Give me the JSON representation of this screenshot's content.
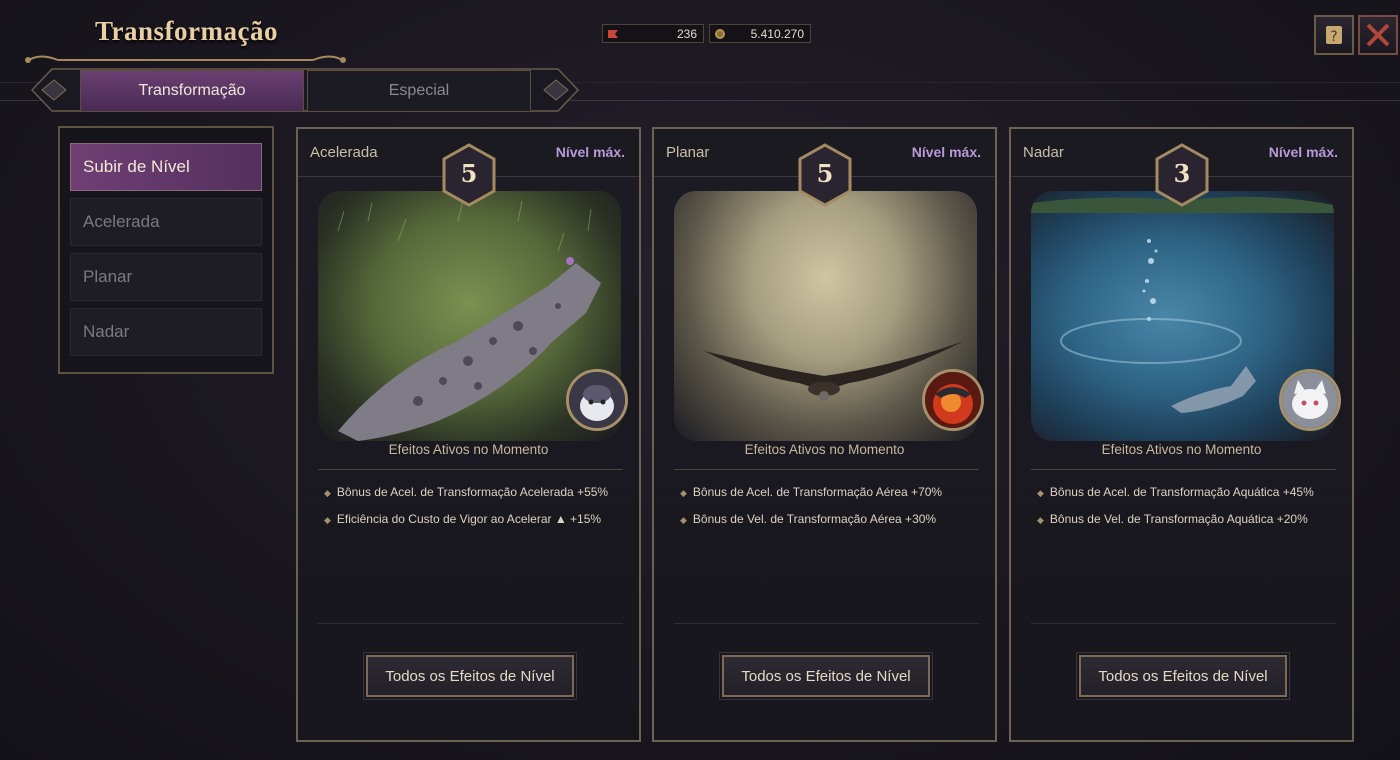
{
  "header": {
    "title": "Transformação",
    "currency": [
      {
        "icon": "red-ticket-icon",
        "value": "236"
      },
      {
        "icon": "gold-coin-icon",
        "value": "5.410.270"
      }
    ]
  },
  "tabs": [
    {
      "label": "Transformação",
      "active": true
    },
    {
      "label": "Especial",
      "active": false
    }
  ],
  "left_menu": [
    {
      "label": "Subir de Nível",
      "active": true
    },
    {
      "label": "Acelerada",
      "active": false
    },
    {
      "label": "Planar",
      "active": false
    },
    {
      "label": "Nadar",
      "active": false
    }
  ],
  "cards": [
    {
      "name": "Acelerada",
      "max_label": "Nível máx.",
      "level": "5",
      "effects_title": "Efeitos Ativos no Momento",
      "effects": [
        "Bônus de Acel. de Transformação Acelerada +55%",
        "Eficiência do Custo de Vigor ao Acelerar ▲ +15%"
      ],
      "button": "Todos os Efeitos de Nível"
    },
    {
      "name": "Planar",
      "max_label": "Nível máx.",
      "level": "5",
      "effects_title": "Efeitos Ativos no Momento",
      "effects": [
        "Bônus de Acel. de Transformação Aérea +70%",
        "Bônus de Vel. de Transformação Aérea  +30%"
      ],
      "button": "Todos os Efeitos de Nível"
    },
    {
      "name": "Nadar",
      "max_label": "Nível máx.",
      "level": "3",
      "effects_title": "Efeitos Ativos no Momento",
      "effects": [
        "Bônus de Acel. de Transformação Aquática +45%",
        "Bônus de Vel. de Transformação Aquática +20%"
      ],
      "button": "Todos os Efeitos de Nível"
    }
  ],
  "colors": {
    "accent": "#6a3f72",
    "max_label": "#b89ad9",
    "gold": "#e9cfa3"
  }
}
